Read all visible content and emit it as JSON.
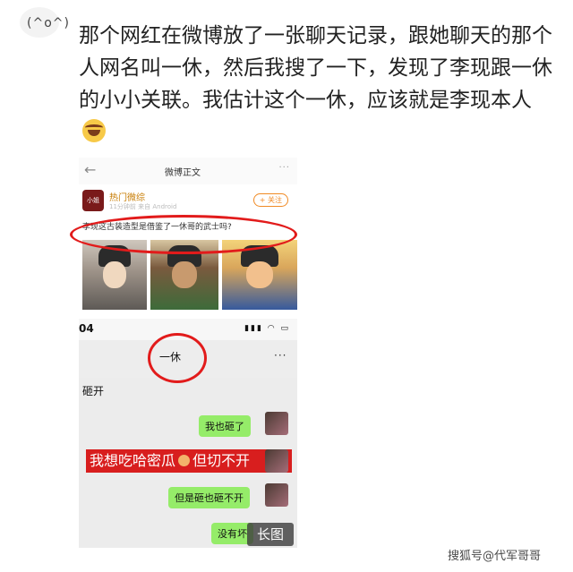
{
  "post": {
    "avatar_text": "(^o^)",
    "text": "那个网红在微博放了一张聊天记录，跟她聊天的那个人网名叫一休，然后我搜了一下，发现了李现跟一休的小小关联。我估计这个一休，应该就是李现本人"
  },
  "weibo_screenshot": {
    "back_icon": "←",
    "title": "微博正文",
    "more": "···",
    "user_avatar_text": "小姐",
    "user_name": "热门微综",
    "user_meta": "11分钟前 来自 Android",
    "follow_label": "+ 关注",
    "question": "李现这古装造型是借鉴了一休哥的武士吗?"
  },
  "chat_screenshot": {
    "time": "04",
    "status_icons": "▮▮▮ ◠ ▭",
    "contact_name": "一休",
    "menu": "···",
    "peer_message": "砸开",
    "msg1": "我也砸了",
    "highlight": "我想吃哈密瓜",
    "highlight_tail": "但切不开",
    "msg2": "但是砸也砸不开",
    "msg3": "没有坏",
    "long_image_badge": "长图"
  },
  "watermark": "搜狐号@代军哥哥"
}
